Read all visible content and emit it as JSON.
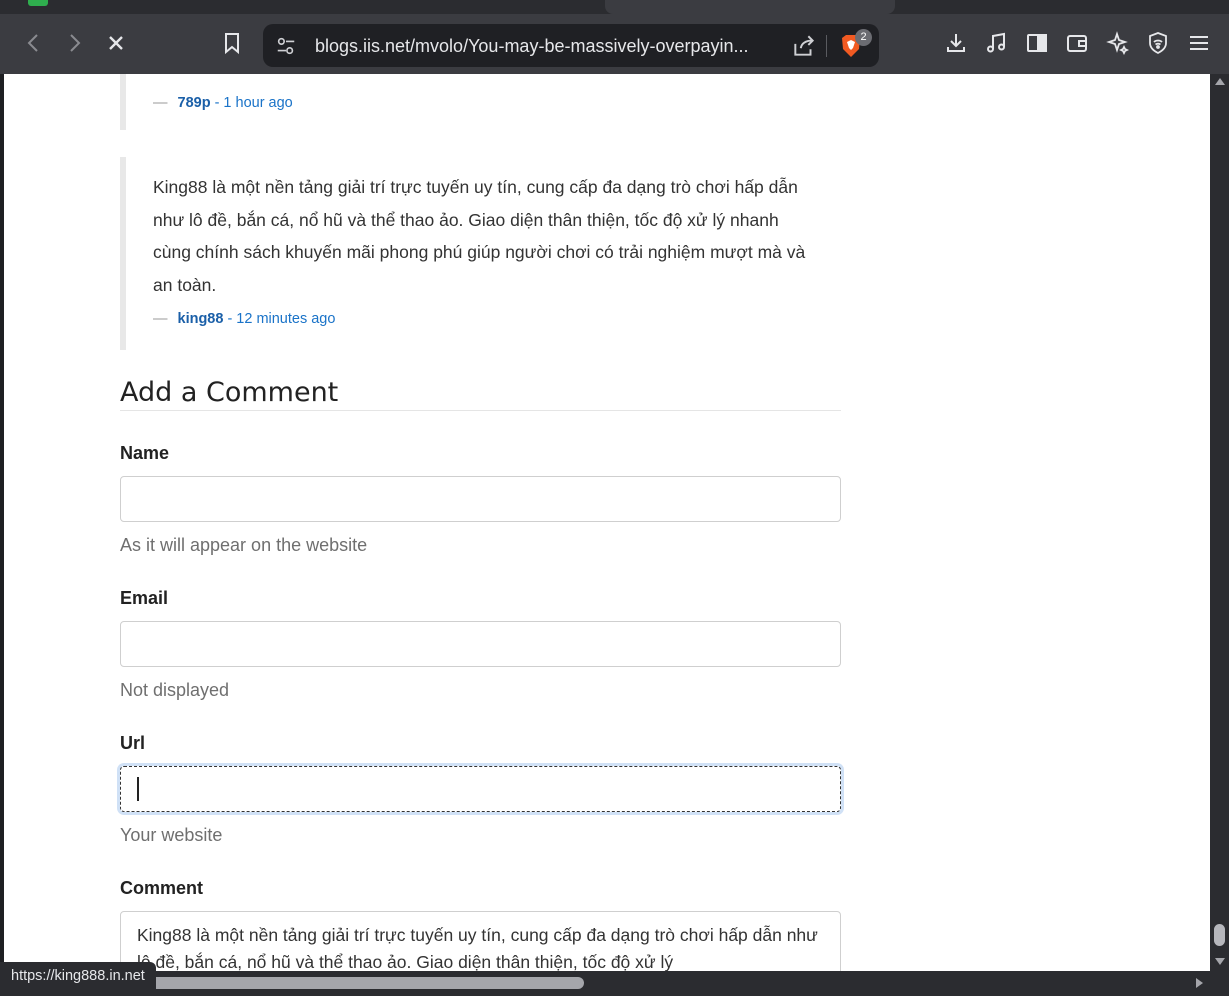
{
  "browser": {
    "url": "blogs.iis.net/mvolo/You-may-be-massively-overpayin...",
    "shields_count": "2",
    "status_link": "https://king888.in.net"
  },
  "comments": [
    {
      "body": "",
      "author": "789p",
      "time": "1 hour ago"
    },
    {
      "body": "King88 là một nền tảng giải trí trực tuyến uy tín, cung cấp đa dạng trò chơi hấp dẫn như lô đề, bắn cá, nổ hũ và thể thao ảo. Giao diện thân thiện, tốc độ xử lý nhanh cùng chính sách khuyến mãi phong phú giúp người chơi có trải nghiệm mượt mà và an toàn.",
      "author": "king88",
      "time": "12 minutes ago"
    }
  ],
  "form": {
    "title": "Add a Comment",
    "name_label": "Name",
    "name_value": "",
    "name_hint": "As it will appear on the website",
    "email_label": "Email",
    "email_value": "",
    "email_hint": "Not displayed",
    "url_label": "Url",
    "url_value": "",
    "url_hint": "Your website",
    "comment_label": "Comment",
    "comment_value": "King88 là một nền tảng giải trí trực tuyến uy tín, cung cấp đa dạng trò chơi hấp dẫn như lô đề, bắn cá, nổ hũ và thể thao ảo. Giao diện thân thiện, tốc độ xử lý"
  },
  "colors": {
    "link": "#1a73c8",
    "toolbar": "#3b3c41",
    "focus": "#78aae6"
  }
}
